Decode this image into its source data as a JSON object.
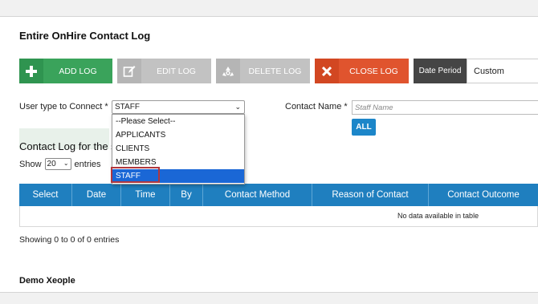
{
  "page": {
    "title": "Entire OnHire Contact Log"
  },
  "toolbar": {
    "add_label": "ADD LOG",
    "edit_label": "EDIT LOG",
    "delete_label": "DELETE LOG",
    "close_label": "CLOSE LOG",
    "date_period_label": "Date Period",
    "date_period_value": "Custom"
  },
  "filters": {
    "user_type_label": "User type to Connect *",
    "user_type_value": "STAFF",
    "user_type_options": [
      "--Please Select--",
      "APPLICANTS",
      "CLIENTS",
      "MEMBERS",
      "STAFF"
    ],
    "contact_name_label": "Contact Name *",
    "contact_name_placeholder": "Staff Name",
    "all_button": "ALL"
  },
  "log_section": {
    "heading": "Contact Log for the s",
    "show_label": "Show",
    "show_value": "20",
    "entries_label": "entries"
  },
  "table": {
    "columns": [
      "Select",
      "Date",
      "Time",
      "By",
      "Contact Method",
      "Reason of Contact",
      "Contact Outcome"
    ],
    "empty_text": "No data available in table",
    "info": "Showing 0 to 0 of 0 entries"
  },
  "footer": {
    "name": "Demo Xeople"
  },
  "colors": {
    "add": "#3aa35b",
    "close": "#e0542e",
    "disabled": "#c2c2c2",
    "header": "#1f7fbf",
    "selected": "#1a67d6",
    "highlight": "#b1373d"
  },
  "icons": {
    "add": "plus-icon",
    "edit": "pencil-icon",
    "delete": "recycle-icon",
    "close": "x-icon"
  }
}
